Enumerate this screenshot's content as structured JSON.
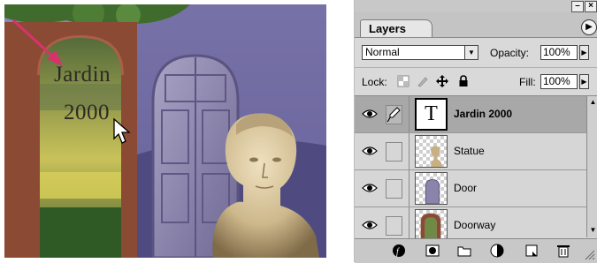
{
  "canvas": {
    "text_line1": "Jardin",
    "text_line2": "2000"
  },
  "palette": {
    "title_buttons": [
      "–",
      "×"
    ],
    "tab_label": "Layers",
    "menu_arrow": "▶",
    "blend_mode": "Normal",
    "opacity_label": "Opacity:",
    "opacity_value": "100%",
    "lock_label": "Lock:",
    "fill_label": "Fill:",
    "fill_value": "100%",
    "layers": [
      {
        "name": "Jardin 2000",
        "type": "text",
        "thumb_glyph": "T",
        "selected": true
      },
      {
        "name": "Statue",
        "type": "image",
        "selected": false
      },
      {
        "name": "Door",
        "type": "image",
        "selected": false
      },
      {
        "name": "Doorway",
        "type": "image",
        "selected": false
      }
    ],
    "bottom_icons": [
      "layer-style-icon",
      "add-mask-icon",
      "new-set-icon",
      "adjustment-layer-icon",
      "new-layer-icon",
      "trash-icon"
    ]
  },
  "colors": {
    "accent_arrow": "#d6336c",
    "selected_row": "#a8a8a8",
    "panel_bg": "#d9d9d9"
  }
}
